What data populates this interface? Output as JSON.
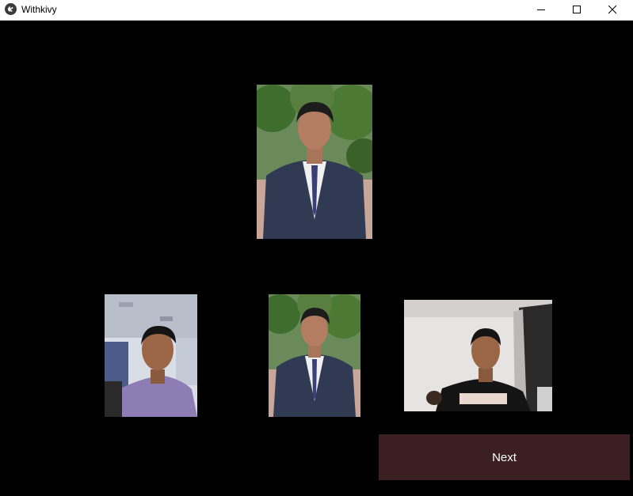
{
  "window": {
    "title": "Withkivy",
    "icon": "kivy-logo-icon",
    "controls": [
      "minimize-icon",
      "maximize-icon",
      "close-icon"
    ]
  },
  "main": {
    "next_label": "Next"
  }
}
